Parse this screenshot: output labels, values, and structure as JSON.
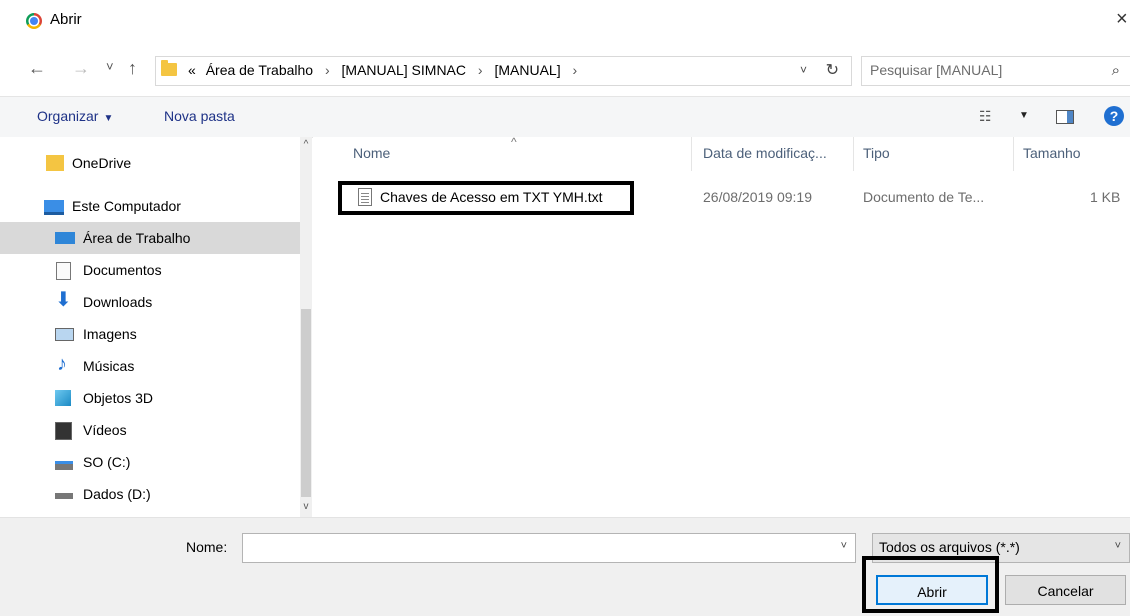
{
  "window": {
    "title": "Abrir",
    "close": "×"
  },
  "nav": {
    "back": "←",
    "forward": "→",
    "recent": "˅",
    "up": "↑"
  },
  "breadcrumb": {
    "overflow": "«",
    "items": [
      "Área de Trabalho",
      "[MANUAL] SIMNAC",
      "[MANUAL]"
    ],
    "sep": "›",
    "dropdown": "˅",
    "refresh": "↻"
  },
  "search": {
    "placeholder": "Pesquisar [MANUAL]",
    "icon": "⌕"
  },
  "toolbar": {
    "organize": "Organizar",
    "new_folder": "Nova pasta",
    "help": "?"
  },
  "sidebar": {
    "items": [
      {
        "label": "OneDrive",
        "icon": "folder-icon"
      },
      {
        "label": "Este Computador",
        "icon": "computer-icon"
      },
      {
        "label": "Área de Trabalho",
        "icon": "desktop-icon",
        "selected": true
      },
      {
        "label": "Documentos",
        "icon": "documents-icon"
      },
      {
        "label": "Downloads",
        "icon": "download-icon"
      },
      {
        "label": "Imagens",
        "icon": "pictures-icon"
      },
      {
        "label": "Músicas",
        "icon": "music-icon"
      },
      {
        "label": "Objetos 3D",
        "icon": "cube-icon"
      },
      {
        "label": "Vídeos",
        "icon": "video-icon"
      },
      {
        "label": "SO (C:)",
        "icon": "drive-icon"
      },
      {
        "label": "Dados (D:)",
        "icon": "drive-icon"
      }
    ]
  },
  "columns": {
    "name": "Nome",
    "modified": "Data de modificaç...",
    "type": "Tipo",
    "size": "Tamanho"
  },
  "files": [
    {
      "name": "Chaves de Acesso em TXT YMH.txt",
      "modified": "26/08/2019 09:19",
      "type": "Documento de Te...",
      "size": "1 KB"
    }
  ],
  "bottom": {
    "name_label": "Nome:",
    "name_value": "",
    "filter": "Todos os arquivos (*.*)",
    "open": "Abrir",
    "cancel": "Cancelar"
  }
}
